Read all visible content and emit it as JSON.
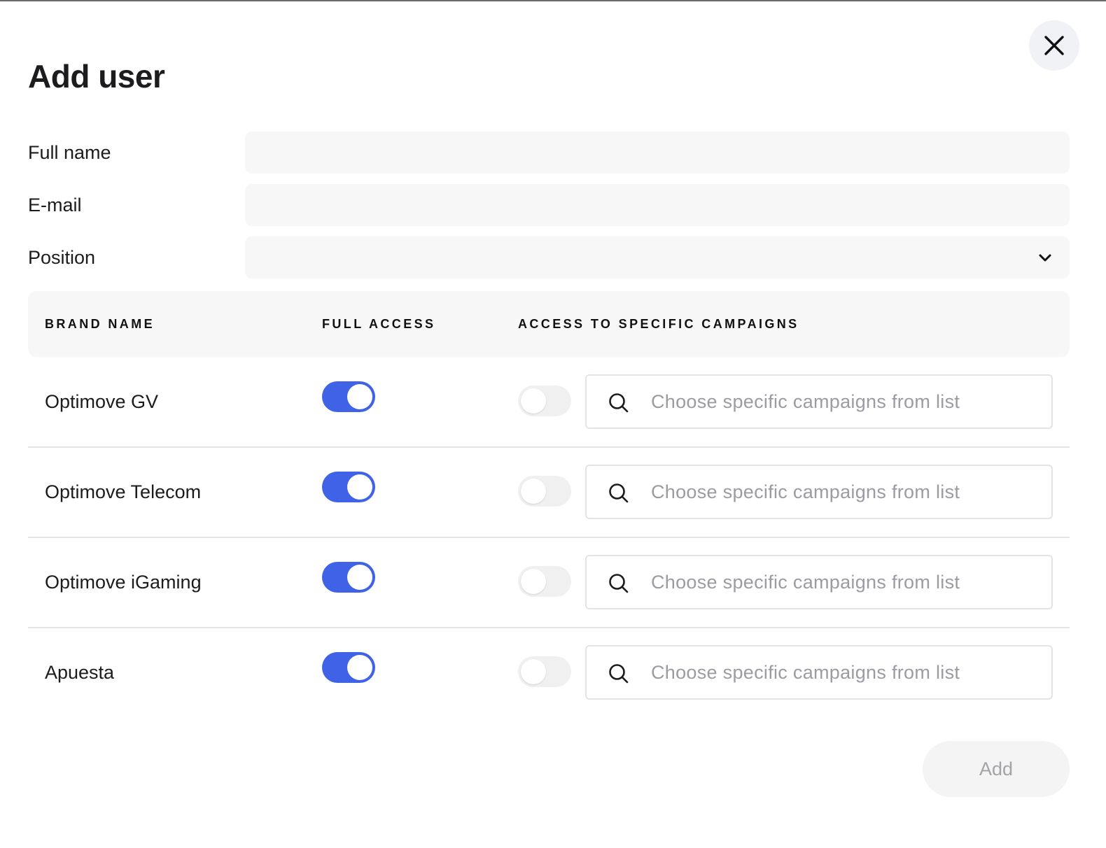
{
  "modal": {
    "title": "Add user",
    "close_icon": "close-icon"
  },
  "form": {
    "full_name": {
      "label": "Full name",
      "value": "",
      "placeholder": ""
    },
    "email": {
      "label": "E-mail",
      "value": "",
      "placeholder": ""
    },
    "position": {
      "label": "Position",
      "value": "",
      "chevron_icon": "chevron-down-icon"
    }
  },
  "table": {
    "headers": {
      "brand": "BRAND NAME",
      "full_access": "FULL ACCESS",
      "specific": "ACCESS TO SPECIFIC CAMPAIGNS"
    },
    "rows": [
      {
        "brand": "Optimove GV",
        "full_access": true,
        "specific_access": false,
        "placeholder": "Choose specific campaigns from list"
      },
      {
        "brand": "Optimove Telecom",
        "full_access": true,
        "specific_access": false,
        "placeholder": "Choose specific campaigns from list"
      },
      {
        "brand": "Optimove iGaming",
        "full_access": true,
        "specific_access": false,
        "placeholder": "Choose specific campaigns from list"
      },
      {
        "brand": "Apuesta",
        "full_access": true,
        "specific_access": false,
        "placeholder": "Choose specific campaigns from list"
      }
    ]
  },
  "actions": {
    "add_label": "Add"
  },
  "colors": {
    "accent": "#4062e6",
    "toggle_off": "#f0f0f0",
    "input_bg": "#f7f7f7",
    "placeholder": "#9b9ba3"
  }
}
